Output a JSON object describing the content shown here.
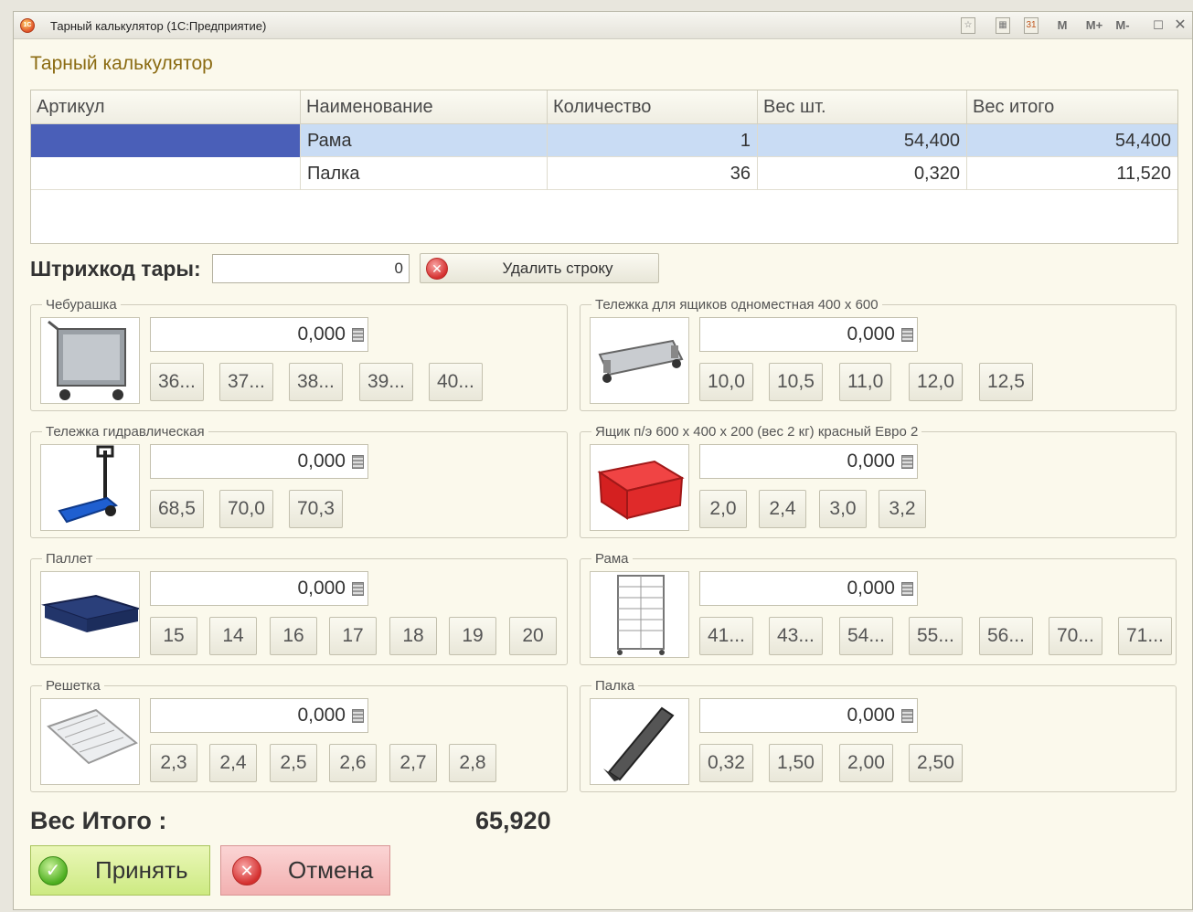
{
  "window": {
    "title": "Тарный калькулятор  (1С:Предприятие)",
    "toolbar": {
      "m": "M",
      "mplus": "M+",
      "mminus": "M-",
      "calendar_day": "31"
    }
  },
  "form_title": "Тарный калькулятор",
  "table": {
    "columns": [
      "Артикул",
      "Наименование",
      "Количество",
      "Вес шт.",
      "Вес итого"
    ],
    "rows": [
      {
        "article": "",
        "name": "Рама",
        "qty": "1",
        "unit_weight": "54,400",
        "total_weight": "54,400"
      },
      {
        "article": "",
        "name": "Палка",
        "qty": "36",
        "unit_weight": "0,320",
        "total_weight": "11,520"
      }
    ]
  },
  "barcode": {
    "label": "Штрихкод тары:",
    "value": "0",
    "delete_label": "Удалить строку"
  },
  "groups": [
    {
      "title": "Чебурашка",
      "value": "0,000",
      "buttons": [
        "36...",
        "37...",
        "38...",
        "39...",
        "40..."
      ],
      "image": "cart-icon"
    },
    {
      "title": "Тележка для ящиков одноместная 400 х 600",
      "value": "0,000",
      "buttons": [
        "10,0",
        "10,5",
        "11,0",
        "12,0",
        "12,5"
      ],
      "image": "dolly-icon"
    },
    {
      "title": "Тележка гидравлическая",
      "value": "0,000",
      "buttons": [
        "68,5",
        "70,0",
        "70,3"
      ],
      "image": "pallet-jack-icon"
    },
    {
      "title": "Ящик п/э 600 х 400 х 200 (вес 2 кг) красный Евро 2",
      "value": "0,000",
      "buttons": [
        "2,0",
        "2,4",
        "3,0",
        "3,2"
      ],
      "image": "crate-icon"
    },
    {
      "title": "Паллет",
      "value": "0,000",
      "buttons": [
        "15",
        "14",
        "16",
        "17",
        "18",
        "19",
        "20"
      ],
      "image": "pallet-icon"
    },
    {
      "title": "Рама",
      "value": "0,000",
      "buttons": [
        "41...",
        "43...",
        "54...",
        "55...",
        "56...",
        "70...",
        "71..."
      ],
      "image": "rack-icon"
    },
    {
      "title": "Решетка",
      "value": "0,000",
      "buttons": [
        "2,3",
        "2,4",
        "2,5",
        "2,6",
        "2,7",
        "2,8"
      ],
      "image": "grate-icon"
    },
    {
      "title": "Палка",
      "value": "0,000",
      "buttons": [
        "0,32",
        "1,50",
        "2,00",
        "2,50"
      ],
      "image": "stick-icon"
    }
  ],
  "total": {
    "label": "Вес Итого :",
    "value": "65,920"
  },
  "actions": {
    "ok": "Принять",
    "cancel": "Отмена"
  },
  "colors": {
    "title_gold": "#8b6b12",
    "selected_row": "#c9dcf4",
    "cursor_cell": "#4a5fb8",
    "ok_bg": "#d6ee8f",
    "cancel_bg": "#f5bcbc"
  }
}
